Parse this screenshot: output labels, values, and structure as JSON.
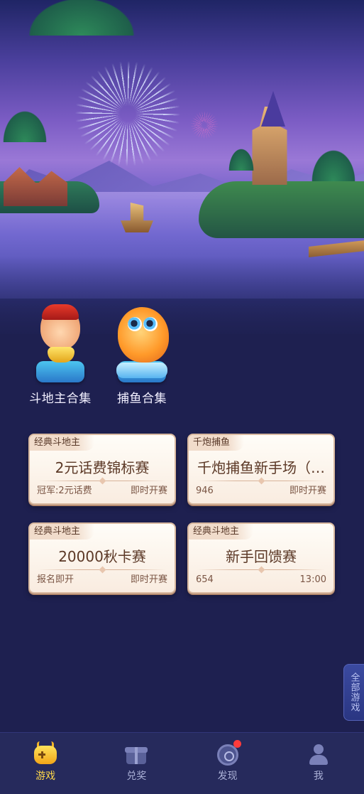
{
  "shortcuts": [
    {
      "label": "斗地主合集",
      "icon": "landlord-icon"
    },
    {
      "label": "捕鱼合集",
      "icon": "fish-icon"
    }
  ],
  "cards": [
    {
      "tag": "经典斗地主",
      "title": "2元话费锦标赛",
      "meta_left": "冠军:2元话费",
      "meta_right": "即时开赛"
    },
    {
      "tag": "千炮捕鱼",
      "title": "千炮捕鱼新手场（…",
      "meta_left": "946",
      "meta_right": "即时开赛"
    },
    {
      "tag": "经典斗地主",
      "title": "20000秋卡赛",
      "meta_left": "报名即开",
      "meta_right": "即时开赛"
    },
    {
      "tag": "经典斗地主",
      "title": "新手回馈赛",
      "meta_left": "654",
      "meta_right": "13:00"
    }
  ],
  "side_tab": {
    "label": "全部游戏"
  },
  "nav": [
    {
      "label": "游戏",
      "icon": "gamepad-icon",
      "active": true
    },
    {
      "label": "兑奖",
      "icon": "gift-icon",
      "active": false
    },
    {
      "label": "发现",
      "icon": "discover-icon",
      "active": false
    },
    {
      "label": "我",
      "icon": "user-icon",
      "active": false
    }
  ],
  "colors": {
    "background": "#1e2050",
    "card_title": "#5b3826",
    "nav_active": "#ffd84a",
    "nav_inactive": "#aab0d6",
    "notify": "#ff3b3b"
  }
}
